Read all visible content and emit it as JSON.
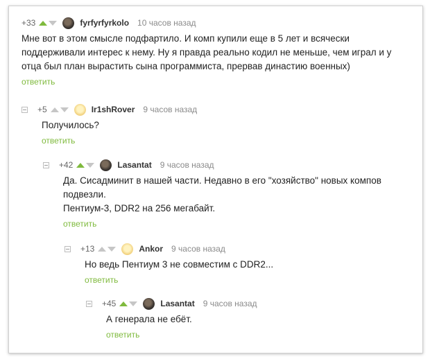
{
  "comments": [
    {
      "rating": "+33",
      "author": "fyrfyrfyrkolo",
      "time": "10 часов назад",
      "lines": [
        "Мне вот в этом смысле подфартило. И комп купили еще в 5 лет и всячески",
        "поддерживали интерес к нему. Ну я правда реально кодил не меньше, чем играл и у",
        "отца был план вырастить сына программиста, прервав династию военных)"
      ],
      "reply": "ответить"
    },
    {
      "rating": "+5",
      "author": "Ir1shRover",
      "time": "9 часов назад",
      "lines": [
        "Получилось?"
      ],
      "reply": "ответить"
    },
    {
      "rating": "+42",
      "author": "Lasantat",
      "time": "9 часов назад",
      "lines": [
        "Да. Сисадминит в нашей части. Недавно в его \"хозяйство\" новых компов",
        "подвезли.",
        "Пентиум-3, DDR2 на 256 мегабайт."
      ],
      "reply": "ответить"
    },
    {
      "rating": "+13",
      "author": "Ankor",
      "time": "9 часов назад",
      "lines": [
        "Но ведь Пентиум 3 не совместим с DDR2..."
      ],
      "reply": "ответить"
    },
    {
      "rating": "+45",
      "author": "Lasantat",
      "time": "9 часов назад",
      "lines": [
        "А генерала не ебёт."
      ],
      "reply": "ответить"
    }
  ],
  "colors": {
    "accent": "#7fba3d",
    "arrow_inactive": "#c6c6c6"
  },
  "icons": {
    "upvote": "arrow-up-icon",
    "downvote": "arrow-down-icon",
    "collapse": "minus-square-icon"
  }
}
